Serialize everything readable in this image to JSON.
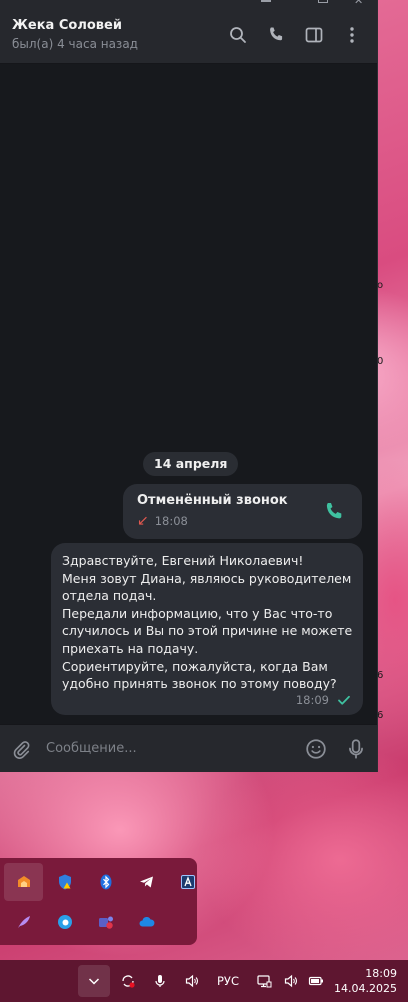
{
  "chat": {
    "peer_name": "Жека Соловей",
    "peer_status": "был(а) 4 часа назад",
    "date_separator": "14 апреля",
    "call": {
      "title": "Отменённый звонок",
      "time": "18:08"
    },
    "message": {
      "lines": [
        "Здравствуйте, Евгений Николаевич!",
        "Меня зовут Диана, являюсь руководителем",
        "отдела подач.",
        "Передали информацию, что у Вас что-то",
        "случилось и Вы по этой причине не можете",
        "приехать на подачу.",
        "Сориентируйте, пожалуйста, когда Вам",
        "удобно принять звонок по этому поводу?"
      ],
      "time": "18:09",
      "status_icon": "single-check-icon"
    },
    "composer_placeholder": "Сообщение..."
  },
  "edge_fragments": [
    "o",
    "0",
    "6",
    "6"
  ],
  "taskbar": {
    "language": "РУС",
    "time": "18:09",
    "date": "14.04.2025"
  },
  "colors": {
    "accent": "#3fc1a0",
    "missed": "#e0584f",
    "bubble": "#2b2e35",
    "window_bg": "#17191d"
  }
}
